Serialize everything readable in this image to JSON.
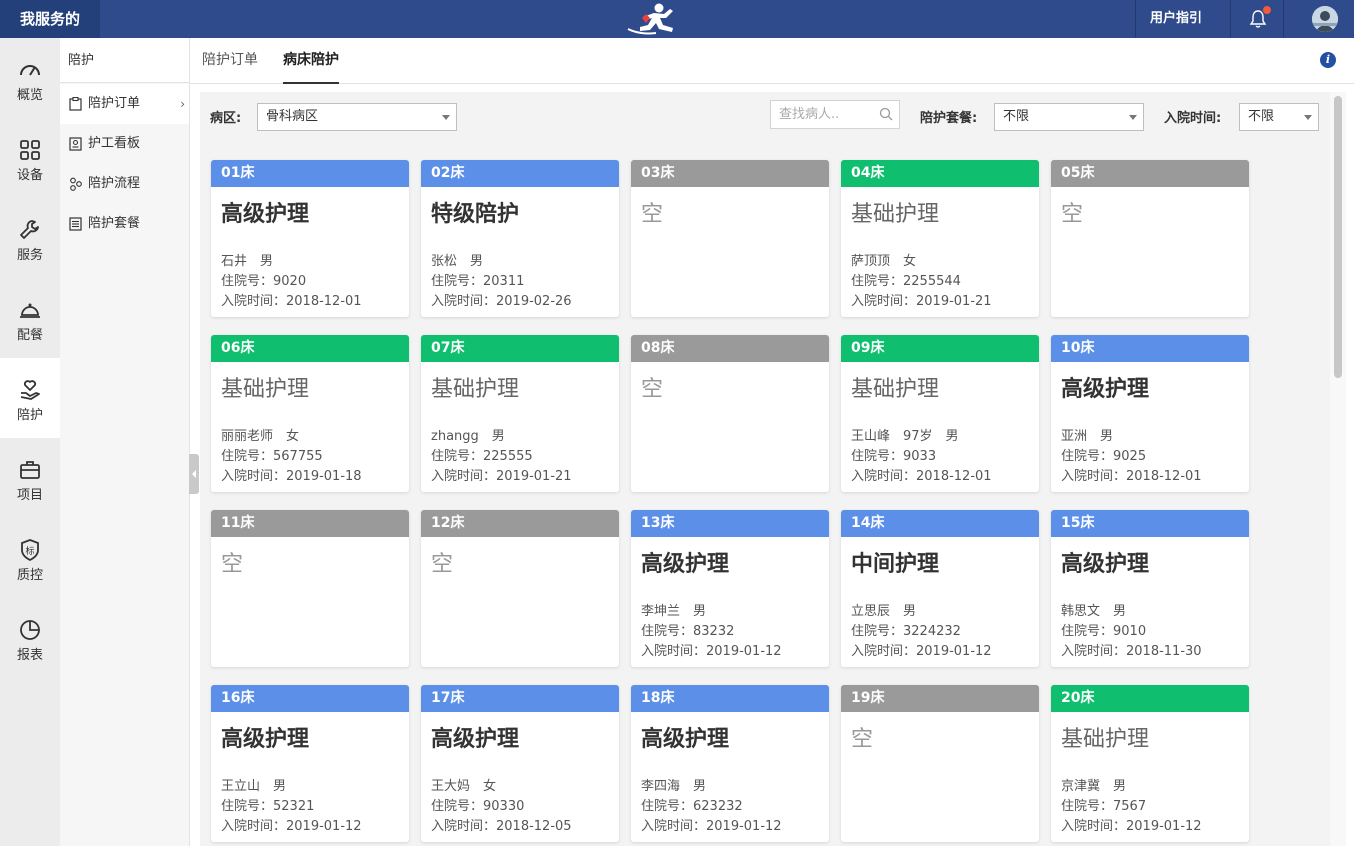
{
  "topbar": {
    "brand": "我服务的",
    "guide": "用户指引"
  },
  "rail": [
    {
      "label": "概览",
      "icon": "speedometer-icon"
    },
    {
      "label": "设备",
      "icon": "grid-icon"
    },
    {
      "label": "服务",
      "icon": "wrench-icon"
    },
    {
      "label": "配餐",
      "icon": "cloche-icon"
    },
    {
      "label": "陪护",
      "icon": "heart-hand-icon"
    },
    {
      "label": "项目",
      "icon": "briefcase-icon"
    },
    {
      "label": "质控",
      "icon": "shield-icon"
    },
    {
      "label": "报表",
      "icon": "pie-chart-icon"
    }
  ],
  "subside": {
    "title": "陪护",
    "items": [
      {
        "label": "陪护订单",
        "icon": "clipboard-icon"
      },
      {
        "label": "护工看板",
        "icon": "id-card-icon"
      },
      {
        "label": "陪护流程",
        "icon": "flow-icon"
      },
      {
        "label": "陪护套餐",
        "icon": "list-icon"
      }
    ]
  },
  "tabs": [
    "陪护订单",
    "病床陪护"
  ],
  "filters": {
    "ward_label": "病区:",
    "ward_value": "骨科病区",
    "search_placeholder": "查找病人..",
    "package_label": "陪护套餐:",
    "package_value": "不限",
    "admit_label": "入院时间:",
    "admit_value": "不限"
  },
  "labels": {
    "inpatient_no": "住院号：",
    "admit_time": "入院时间：",
    "empty": "空"
  },
  "colors": {
    "senior": "#5b8fe8",
    "special": "#5b8fe8",
    "basic": "#0fbe6e",
    "middle": "#5b8fe8",
    "empty": "#9a9a9a"
  },
  "beds": [
    {
      "bed": "01床",
      "type": "senior",
      "service": "高级护理",
      "patient": "石井　男",
      "inpatient": "9020",
      "admit": "2018-12-01"
    },
    {
      "bed": "02床",
      "type": "special",
      "service": "特级陪护",
      "patient": "张松　男",
      "inpatient": "20311",
      "admit": "2019-02-26"
    },
    {
      "bed": "03床",
      "type": "empty"
    },
    {
      "bed": "04床",
      "type": "basic",
      "service": "基础护理",
      "patient": "萨顶顶　女",
      "inpatient": "2255544",
      "admit": "2019-01-21"
    },
    {
      "bed": "05床",
      "type": "empty"
    },
    {
      "bed": "06床",
      "type": "basic",
      "service": "基础护理",
      "patient": "丽丽老师　女",
      "inpatient": "567755",
      "admit": "2019-01-18"
    },
    {
      "bed": "07床",
      "type": "basic",
      "service": "基础护理",
      "patient": "zhangg　男",
      "inpatient": "225555",
      "admit": "2019-01-21"
    },
    {
      "bed": "08床",
      "type": "empty"
    },
    {
      "bed": "09床",
      "type": "basic",
      "service": "基础护理",
      "patient": "王山峰　97岁　男",
      "inpatient": "9033",
      "admit": "2018-12-01"
    },
    {
      "bed": "10床",
      "type": "senior",
      "service": "高级护理",
      "patient": "亚洲　男",
      "inpatient": "9025",
      "admit": "2018-12-01"
    },
    {
      "bed": "11床",
      "type": "empty"
    },
    {
      "bed": "12床",
      "type": "empty"
    },
    {
      "bed": "13床",
      "type": "senior",
      "service": "高级护理",
      "patient": "李坤兰　男",
      "inpatient": "83232",
      "admit": "2019-01-12"
    },
    {
      "bed": "14床",
      "type": "middle",
      "service": "中间护理",
      "patient": "立思辰　男",
      "inpatient": "3224232",
      "admit": "2019-01-12"
    },
    {
      "bed": "15床",
      "type": "senior",
      "service": "高级护理",
      "patient": "韩思文　男",
      "inpatient": "9010",
      "admit": "2018-11-30"
    },
    {
      "bed": "16床",
      "type": "senior",
      "service": "高级护理",
      "patient": "王立山　男",
      "inpatient": "52321",
      "admit": "2019-01-12"
    },
    {
      "bed": "17床",
      "type": "senior",
      "service": "高级护理",
      "patient": "王大妈　女",
      "inpatient": "90330",
      "admit": "2018-12-05"
    },
    {
      "bed": "18床",
      "type": "senior",
      "service": "高级护理",
      "patient": "李四海　男",
      "inpatient": "623232",
      "admit": "2019-01-12"
    },
    {
      "bed": "19床",
      "type": "empty"
    },
    {
      "bed": "20床",
      "type": "basic",
      "service": "基础护理",
      "patient": "京津冀　男",
      "inpatient": "7567",
      "admit": "2019-01-12"
    }
  ]
}
